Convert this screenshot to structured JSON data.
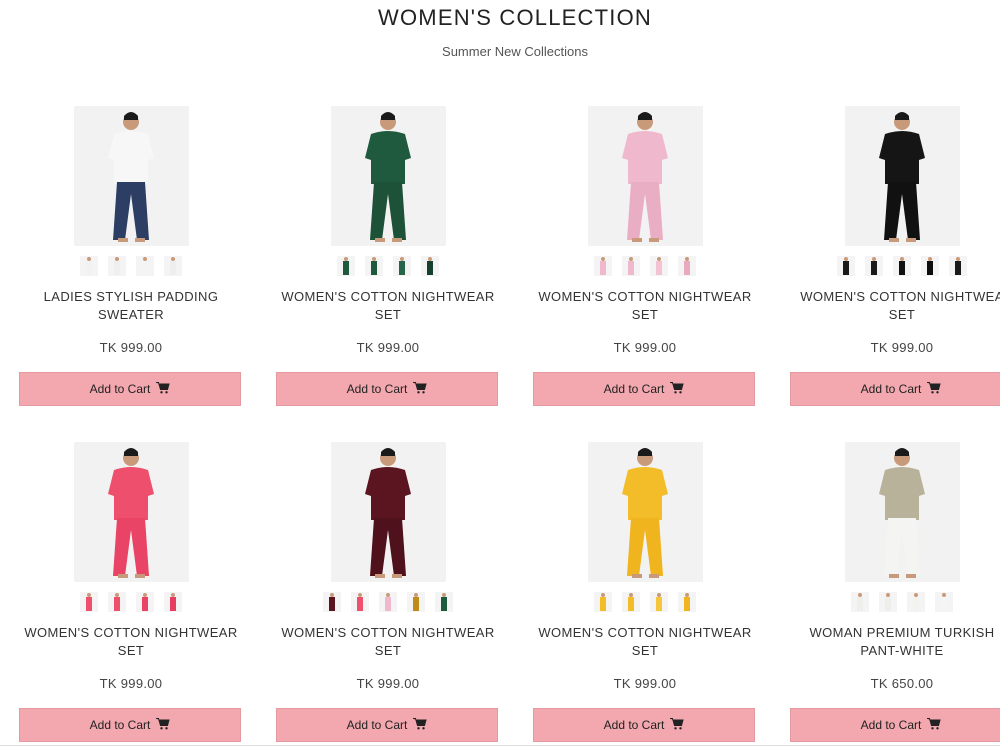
{
  "header": {
    "title": "WOMEN'S COLLECTION",
    "subtitle": "Summer New Collections"
  },
  "products": [
    {
      "name": "LADIES STYLISH PADDING\nSWEATER",
      "price": "TK 999.00",
      "cart_label": "Add to Cart",
      "top_color": "#f7f7f7",
      "bottom_color": "#2c3e63",
      "thumb_colors": [
        "#f2f2f2",
        "#efefef",
        "#f4f4f4",
        "#eeeeee"
      ]
    },
    {
      "name": "WOMEN'S COTTON NIGHTWEAR\nSET",
      "price": "TK 999.00",
      "cart_label": "Add to Cart",
      "top_color": "#1f5a3e",
      "bottom_color": "#1d5239",
      "thumb_colors": [
        "#1f5a3e",
        "#1f5a3e",
        "#27654a",
        "#14402d"
      ]
    },
    {
      "name": "WOMEN'S COTTON NIGHTWEAR\nSET",
      "price": "TK 999.00",
      "cart_label": "Add to Cart",
      "top_color": "#efb8cc",
      "bottom_color": "#eaaec4",
      "thumb_colors": [
        "#efb8cc",
        "#efb8cc",
        "#f3c2d3",
        "#e9a9c0"
      ]
    },
    {
      "name": "WOMEN'S COTTON NIGHTWEA\nSET",
      "price": "TK 999.00",
      "cart_label": "Add to Cart",
      "top_color": "#151515",
      "bottom_color": "#111111",
      "thumb_colors": [
        "#1a1a1a",
        "#1a1a1a",
        "#111111",
        "#0d0d0d",
        "#1a1a1a"
      ]
    },
    {
      "name": "WOMEN'S COTTON NIGHTWEAR\nSET",
      "price": "TK 999.00",
      "cart_label": "Add to Cart",
      "top_color": "#ee4f6d",
      "bottom_color": "#e94465",
      "thumb_colors": [
        "#ee4f6d",
        "#ee4f6d",
        "#e94465",
        "#e63e60"
      ]
    },
    {
      "name": "WOMEN'S COTTON NIGHTWEAR\nSET",
      "price": "TK 999.00",
      "cart_label": "Add to Cart",
      "top_color": "#5b1520",
      "bottom_color": "#4f111b",
      "thumb_colors": [
        "#5b1520",
        "#ee4f6d",
        "#efb8cc",
        "#c08a1a",
        "#1f5a3e"
      ]
    },
    {
      "name": "WOMEN'S COTTON NIGHTWEAR\nSET",
      "price": "TK 999.00",
      "cart_label": "Add to Cart",
      "top_color": "#f3bd2a",
      "bottom_color": "#efb41e",
      "thumb_colors": [
        "#f3bd2a",
        "#f3bd2a",
        "#f6c63a",
        "#efb41e"
      ]
    },
    {
      "name": "WOMAN PREMIUM TURKISH\nPANT-WHITE",
      "price": "TK 650.00",
      "cart_label": "Add to Cart",
      "top_color": "#b9b29a",
      "bottom_color": "#f4f4f2",
      "thumb_colors": [
        "#eeeeea",
        "#eeeeea",
        "#f2f2ee",
        "#f5f5f3"
      ]
    }
  ],
  "icons": {
    "cart": "shopping-cart-icon"
  },
  "colors": {
    "button_bg": "#f2a8ae",
    "button_border": "#e49aa1"
  }
}
